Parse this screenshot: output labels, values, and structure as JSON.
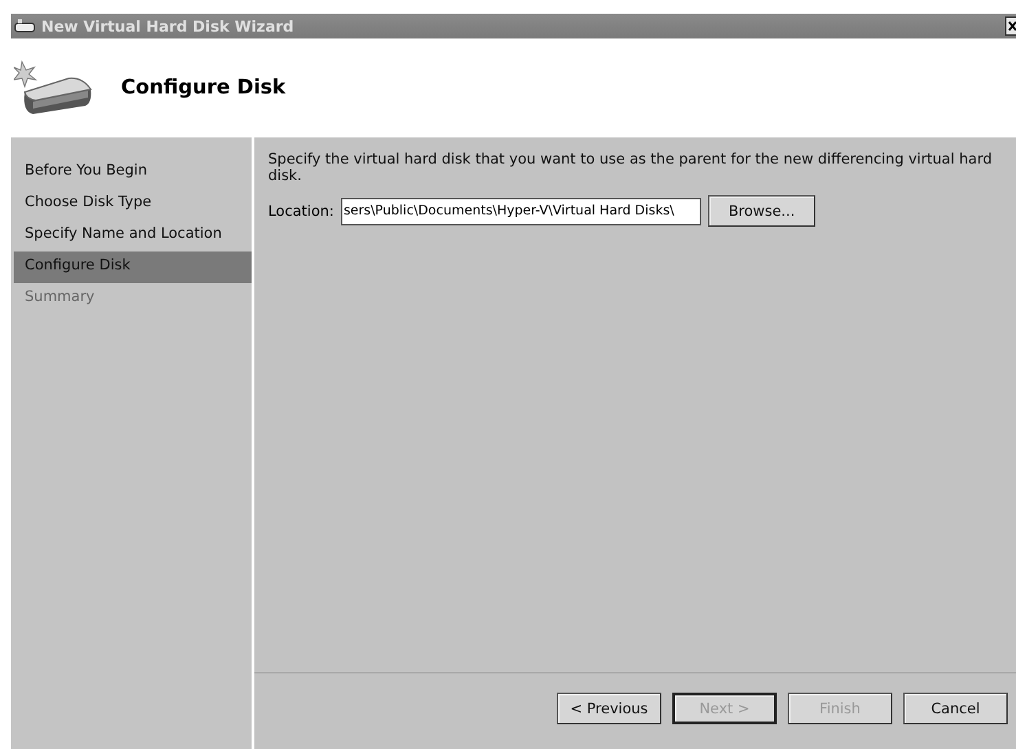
{
  "window": {
    "title": "New Virtual Hard Disk Wizard"
  },
  "header": {
    "title": "Configure Disk"
  },
  "steps": [
    {
      "label": "Before You Begin",
      "selected": false,
      "disabled": false
    },
    {
      "label": "Choose Disk Type",
      "selected": false,
      "disabled": false
    },
    {
      "label": "Specify Name and Location",
      "selected": false,
      "disabled": false
    },
    {
      "label": "Configure Disk",
      "selected": true,
      "disabled": false
    },
    {
      "label": "Summary",
      "selected": false,
      "disabled": true
    }
  ],
  "description": "Specify the virtual hard disk that you want to use as the parent for the new differencing virtual hard disk.",
  "location": {
    "label": "Location:",
    "value": "sers\\Public\\Documents\\Hyper-V\\Virtual Hard Disks\\",
    "browse": "Browse..."
  },
  "buttons": [
    {
      "label": "< Previous",
      "disabled": false,
      "default": false
    },
    {
      "label": "Next >",
      "disabled": true,
      "default": true
    },
    {
      "label": "Finish",
      "disabled": true,
      "default": false
    },
    {
      "label": "Cancel",
      "disabled": false,
      "default": false
    }
  ]
}
